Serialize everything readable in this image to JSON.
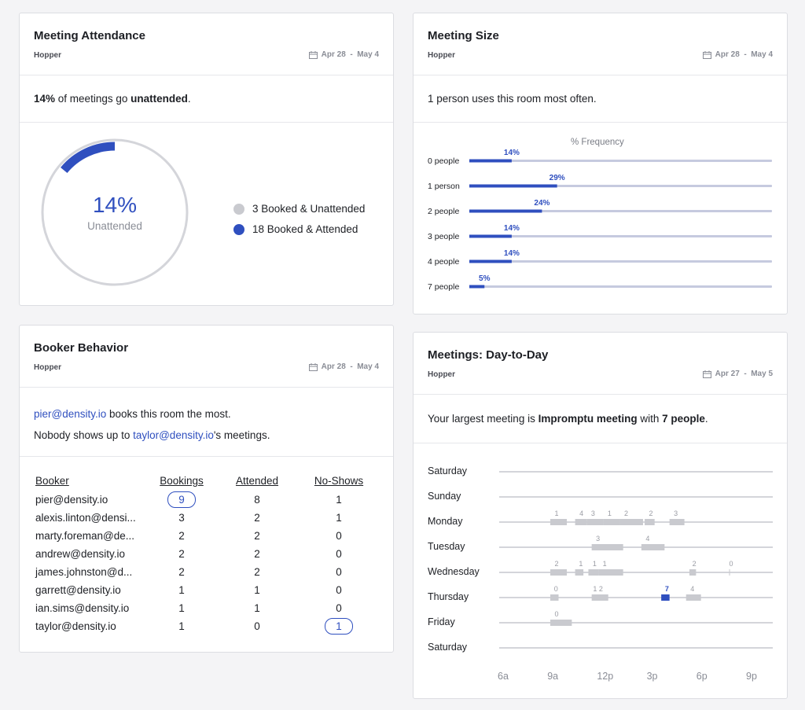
{
  "attendance": {
    "title": "Meeting Attendance",
    "room": "Hopper",
    "date_range": "Apr 28  -  May 4",
    "summary_pct": "14%",
    "summary_mid": "of meetings go",
    "summary_word": "unattended",
    "donut_pct_value": 14,
    "donut_pct_label": "14%",
    "donut_caption": "Unattended",
    "legend": [
      {
        "label": "3 Booked & Unattended",
        "color": "#c9cacf"
      },
      {
        "label": "18 Booked & Attended",
        "color": "#2f4fbf"
      }
    ]
  },
  "size": {
    "title": "Meeting Size",
    "room": "Hopper",
    "date_range": "Apr 28  -  May 4",
    "summary": "1 person uses this room most often.",
    "chart_title": "% Frequency",
    "chart_data": {
      "type": "bar",
      "categories": [
        "0 people",
        "1 person",
        "2 people",
        "3 people",
        "4 people",
        "7 people"
      ],
      "values": [
        14,
        29,
        24,
        14,
        14,
        5
      ],
      "value_labels": [
        "14%",
        "29%",
        "24%",
        "14%",
        "14%",
        "5%"
      ],
      "title": "% Frequency",
      "ylim": [
        0,
        100
      ]
    }
  },
  "booker": {
    "title": "Booker Behavior",
    "room": "Hopper",
    "date_range": "Apr 28  -  May 4",
    "line1_email": "pier@density.io",
    "line1_rest": "books this room the most.",
    "line2_pre": "Nobody shows up to",
    "line2_email": "taylor@density.io",
    "line2_rest": "'s meetings.",
    "headers": [
      "Booker",
      "Bookings",
      "Attended",
      "No-Shows"
    ],
    "rows": [
      {
        "booker": "pier@density.io",
        "bookings": "9",
        "attended": "8",
        "noshows": "1"
      },
      {
        "booker": "alexis.linton@densi...",
        "bookings": "3",
        "attended": "2",
        "noshows": "1"
      },
      {
        "booker": "marty.foreman@de...",
        "bookings": "2",
        "attended": "2",
        "noshows": "0"
      },
      {
        "booker": "andrew@density.io",
        "bookings": "2",
        "attended": "2",
        "noshows": "0"
      },
      {
        "booker": "james.johnston@d...",
        "bookings": "2",
        "attended": "2",
        "noshows": "0"
      },
      {
        "booker": "garrett@density.io",
        "bookings": "1",
        "attended": "1",
        "noshows": "0"
      },
      {
        "booker": "ian.sims@density.io",
        "bookings": "1",
        "attended": "1",
        "noshows": "0"
      },
      {
        "booker": "taylor@density.io",
        "bookings": "1",
        "attended": "0",
        "noshows": "1"
      }
    ]
  },
  "daytoday": {
    "title": "Meetings: Day-to-Day",
    "room": "Hopper",
    "date_range": "Apr 27  -  May 5",
    "summary_pre": "Your largest meeting is",
    "summary_meeting": "Impromptu meeting",
    "summary_mid": "with",
    "summary_people": "7 people",
    "summary_end": ".",
    "chart_data": {
      "type": "timeline",
      "x_ticks": [
        "6a",
        "9a",
        "12p",
        "3p",
        "6p",
        "9p"
      ],
      "x_range_hours": [
        6,
        22
      ],
      "days": [
        {
          "day": "Saturday",
          "meetings": []
        },
        {
          "day": "Sunday",
          "meetings": []
        },
        {
          "day": "Monday",
          "meetings": [
            {
              "start": 8.8,
              "end": 9.8,
              "people": "1"
            },
            {
              "start": 10.3,
              "end": 11.0,
              "people": "4"
            },
            {
              "start": 11.0,
              "end": 12.0,
              "people": "3"
            },
            {
              "start": 12.0,
              "end": 13.0,
              "people": "1"
            },
            {
              "start": 13.0,
              "end": 14.4,
              "people": "2"
            },
            {
              "start": 14.5,
              "end": 15.1,
              "people": "2"
            },
            {
              "start": 16.0,
              "end": 16.9,
              "people": "3"
            }
          ]
        },
        {
          "day": "Tuesday",
          "meetings": [
            {
              "start": 11.3,
              "end": 13.2,
              "people": "3"
            },
            {
              "start": 14.3,
              "end": 15.7,
              "people": "4"
            }
          ]
        },
        {
          "day": "Wednesday",
          "meetings": [
            {
              "start": 8.8,
              "end": 9.8,
              "people": "2"
            },
            {
              "start": 10.3,
              "end": 10.8,
              "people": "1"
            },
            {
              "start": 11.1,
              "end": 11.7,
              "people": "1"
            },
            {
              "start": 11.7,
              "end": 13.2,
              "people": "1"
            },
            {
              "start": 17.2,
              "end": 17.6,
              "people": "2"
            },
            {
              "start": 19.6,
              "end": 19.65,
              "people": "0"
            }
          ]
        },
        {
          "day": "Thursday",
          "meetings": [
            {
              "start": 8.8,
              "end": 9.3,
              "people": "0"
            },
            {
              "start": 11.3,
              "end": 12.3,
              "people": "1 2"
            },
            {
              "start": 15.5,
              "end": 16.0,
              "people": "7",
              "highlight": true
            },
            {
              "start": 17.0,
              "end": 17.9,
              "people": "4"
            }
          ]
        },
        {
          "day": "Friday",
          "meetings": [
            {
              "start": 8.8,
              "end": 10.1,
              "people": "0"
            }
          ]
        },
        {
          "day": "Saturday",
          "meetings": []
        }
      ]
    }
  },
  "colors": {
    "accent": "#2f4fbf",
    "track": "#c6cadf",
    "grey_track": "#d4d5da",
    "meeting_block": "#c9cacf"
  }
}
